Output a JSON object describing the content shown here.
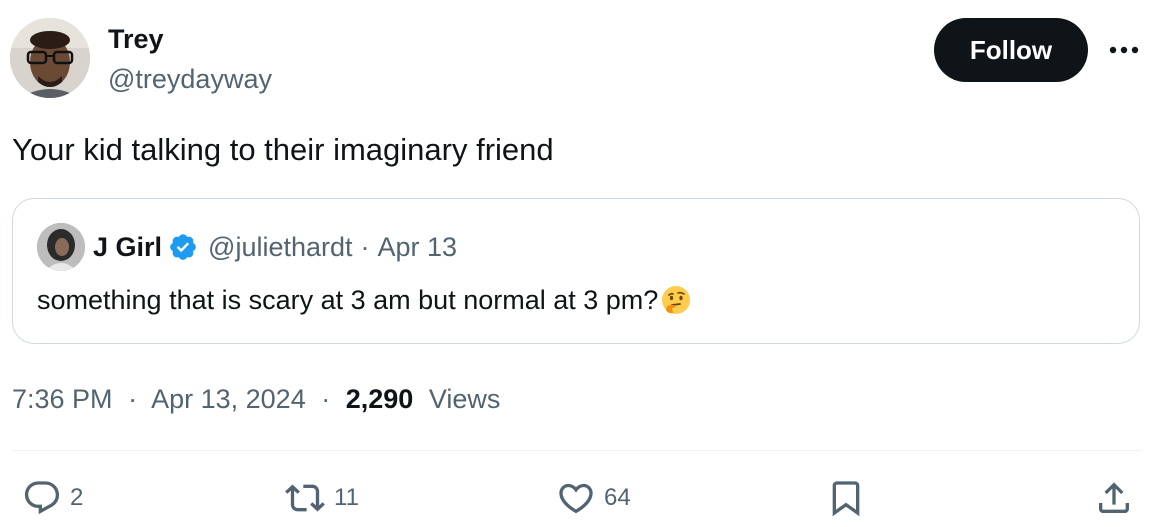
{
  "author": {
    "display_name": "Trey",
    "handle": "@treydayway",
    "avatar_icon": "user-avatar-photo"
  },
  "follow_label": "Follow",
  "more_icon": "more-horizontal-icon",
  "tweet": {
    "text": "Your kid talking to their imaginary friend"
  },
  "quote": {
    "display_name": "J Girl",
    "verified": true,
    "handle": "@juliethardt",
    "separator": "·",
    "date": "Apr 13",
    "text": "something that is scary at 3 am but normal at 3 pm?",
    "emoji_icon": "thinking-face-emoji"
  },
  "meta": {
    "time": "7:36 PM",
    "sep1": "·",
    "date": "Apr 13, 2024",
    "sep2": "·",
    "views_count": "2,290",
    "views_label": "Views"
  },
  "actions": {
    "reply_count": "2",
    "retweet_count": "11",
    "like_count": "64",
    "bookmark_icon": "bookmark-icon",
    "share_icon": "share-icon"
  },
  "colors": {
    "text_primary": "#0f1419",
    "text_secondary": "#536471",
    "border": "#cfd9de",
    "verified_blue": "#1d9bf0",
    "follow_bg": "#0f1419"
  }
}
